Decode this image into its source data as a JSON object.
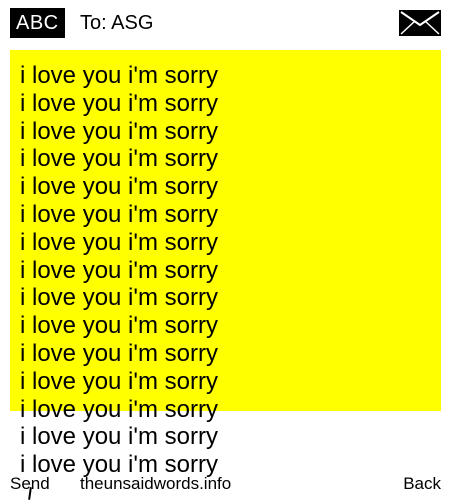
{
  "header": {
    "mode_label": "ABC",
    "recipient": "To: ASG",
    "message_icon": "envelope-icon"
  },
  "message": {
    "highlight_color": "#ffff00",
    "lines": [
      "i love you i'm sorry",
      "i love you i'm sorry",
      "i love you i'm sorry",
      "i love you i'm sorry",
      "i love you i'm sorry",
      "i love you i'm sorry",
      "i love you i'm sorry",
      "i love you i'm sorry",
      "i love you i'm sorry",
      "i love you i'm sorry",
      "i love you i'm sorry",
      "i love you i'm sorry",
      "i love you i'm sorry",
      "i love you i'm sorry",
      "i love you i'm sorry"
    ]
  },
  "footer": {
    "left_label": "Send",
    "site": "theunsaidwords.info",
    "right_label": "Back"
  }
}
